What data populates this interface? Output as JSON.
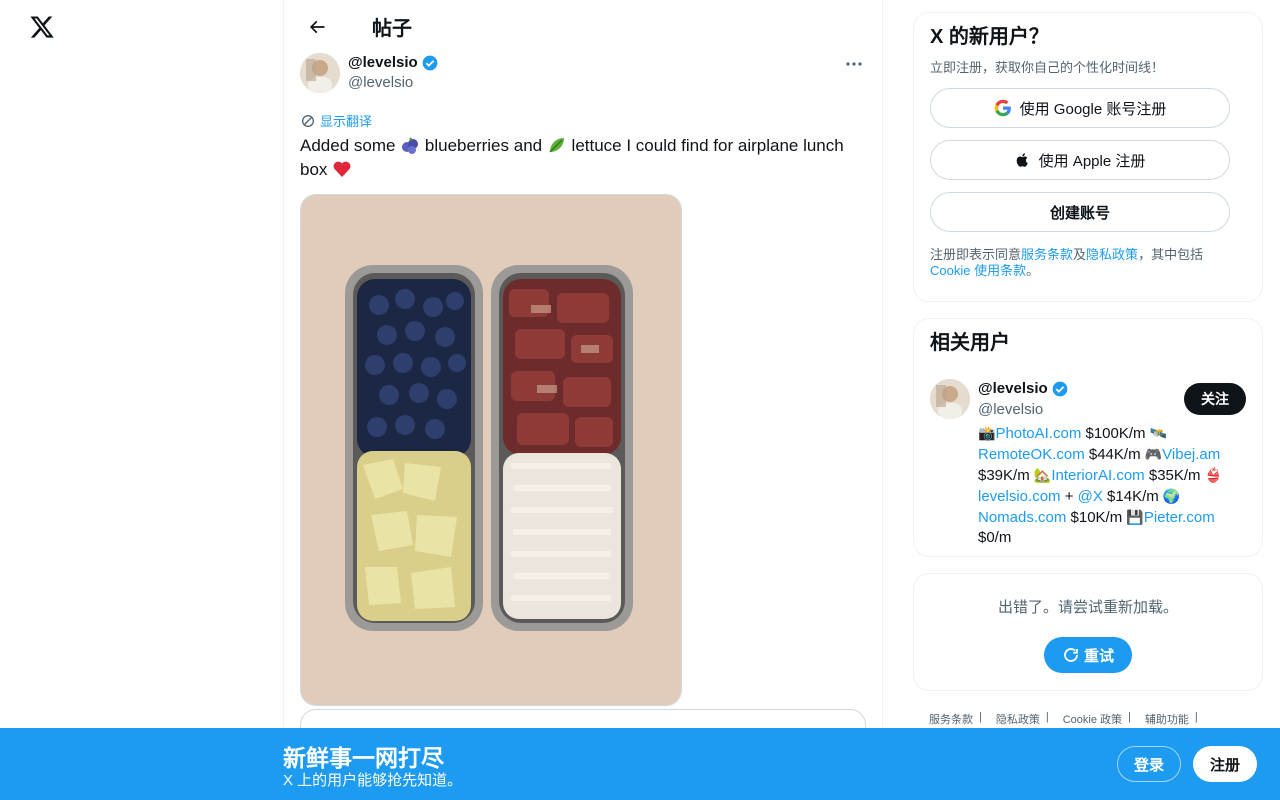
{
  "nav": {
    "logo_icon": "x-logo-icon"
  },
  "header": {
    "title": "帖子",
    "back_icon": "arrow-left-icon"
  },
  "post": {
    "display_name": "@levelsio",
    "handle": "@levelsio",
    "translate_label": "显示翻译",
    "text_part1": "Added some ",
    "text_part2": " blueberries and ",
    "text_part3": " lettuce I could find for airplane lunch box ",
    "emoji_blueberries": "🫐",
    "emoji_lettuce": "🥬",
    "emoji_heart": "❤️",
    "more_icon": "more-icon",
    "media_icon": "lunch-box-photo"
  },
  "signup_card": {
    "title": "X 的新用户？",
    "subtitle": "立即注册，获取你自己的个性化时间线！",
    "google_label": "使用 Google 账号注册",
    "apple_label": "使用 Apple 注册",
    "create_label": "创建账号",
    "legal_prefix": "注册即表示同意",
    "terms": "服务条款",
    "and": "及",
    "privacy": "隐私政策",
    "including": "，其中包括 ",
    "cookie": "Cookie 使用条款",
    "period": "。"
  },
  "related": {
    "title": "相关用户",
    "display_name": "@levelsio",
    "handle": "@levelsio",
    "follow_label": "关注",
    "bio": [
      {
        "icon": "📸",
        "link": "PhotoAI.com",
        "text": " $100K/m "
      },
      {
        "icon": "🛰️",
        "link": "RemoteOK.com",
        "text": " $44K/m "
      },
      {
        "icon": "🎮",
        "link": "Vibej.am",
        "text": " $39K/m "
      },
      {
        "icon": "🏡",
        "link": "InteriorAI.com",
        "text": " $35K/m "
      },
      {
        "icon": "👙",
        "link": "levelsio.com",
        "text": " + "
      },
      {
        "icon": "",
        "link": "@X",
        "text": " $14K/m "
      },
      {
        "icon": "🌍",
        "link": "Nomads.com",
        "text": " $10K/m "
      },
      {
        "icon": "💾",
        "link": "Pieter.com",
        "text": " $0/m"
      }
    ]
  },
  "error_card": {
    "message": "出错了。请尝试重新加载。",
    "retry_label": "重试"
  },
  "footer": {
    "links": [
      "服务条款",
      "隐私政策",
      "Cookie 政策",
      "辅助功能"
    ]
  },
  "bottom_bar": {
    "title": "新鲜事一网打尽",
    "subtitle": "X 上的用户能够抢先知道。",
    "login_label": "登录",
    "signup_label": "注册"
  },
  "colors": {
    "accent": "#1d9bf0",
    "text": "#0f1419",
    "secondary": "#536471",
    "border": "#eff3f4"
  }
}
